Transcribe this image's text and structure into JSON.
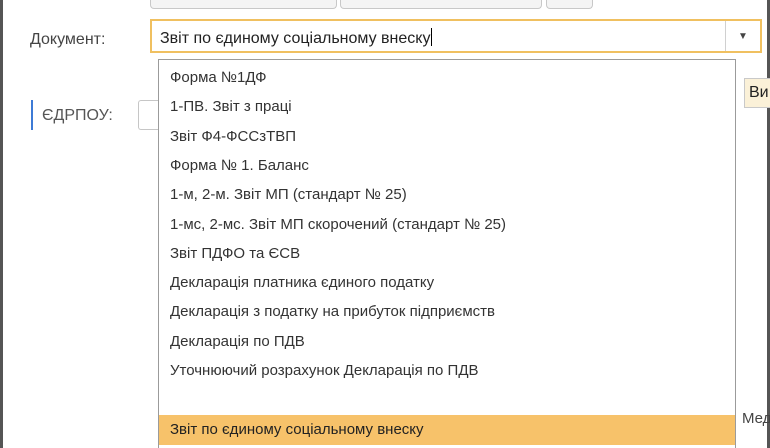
{
  "document": {
    "label": "Документ:",
    "value": "Звіт по єдиному соціальному внеску",
    "dropdown_button": "▼"
  },
  "edrpou": {
    "label": "ЄДРПОУ:"
  },
  "side": {
    "button_label": "Ви",
    "text": "Мед"
  },
  "dropdown": {
    "items": [
      "Форма №1ДФ",
      "1-ПВ. Звіт з праці",
      "Звіт Ф4-ФССзТВП",
      "Форма № 1. Баланс",
      "1-м, 2-м. Звіт МП (стандарт № 25)",
      "1-мс, 2-мс. Звіт МП скорочений (стандарт № 25)",
      "Звіт ПДФО та ЄСВ",
      "Декларація платника єдиного податку",
      "Декларація з податку на прибуток підприємств",
      "Декларація по ПДВ",
      "Уточнюючий розрахунок Декларація по ПДВ",
      "Звіт по єдиному соціальному внеску"
    ],
    "selected_index": 11
  },
  "colors": {
    "accent": "#f7c26a",
    "focus_border": "#f0c060",
    "marker": "#3d7bd6"
  }
}
